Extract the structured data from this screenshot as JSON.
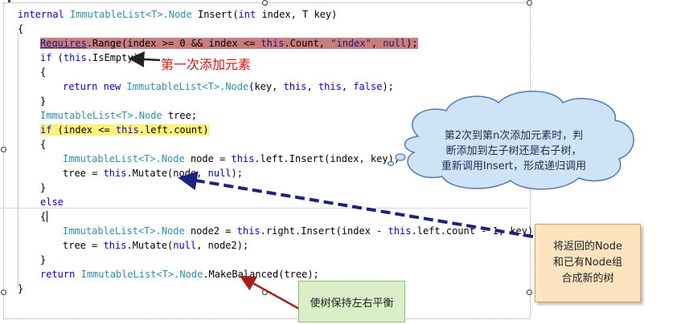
{
  "code": {
    "line1": {
      "internal": "internal",
      "type": "ImmutableList<T>.Node",
      "rest": " Insert(",
      "int": "int",
      "rest2": " index, T key)"
    },
    "line2": "{",
    "line3": {
      "requires": "Requires",
      "rest": ".Range(index >= 0 && index <= ",
      "this": "this",
      "rest2": ".Count, ",
      "str": "\"index\"",
      "rest3": ", ",
      "null": "null",
      "rest4": ");"
    },
    "line4": {
      "if": "if",
      "open": " (",
      "this": "this",
      "rest": ".IsEmpty)"
    },
    "line5": "{",
    "line6": {
      "return": "return",
      "new": "new",
      "type": "ImmutableList<T>.Node",
      "open": "(key, ",
      "this1": "this",
      "comma": ", ",
      "this2": "this",
      "comma2": ", ",
      "false": "false",
      "close": ");"
    },
    "line7": "}",
    "line8": {
      "type": "ImmutableList<T>.Node",
      "rest": " tree;"
    },
    "line9": {
      "if": "if",
      "open": " (index <= ",
      "this": "this",
      "rest": ".left.count)"
    },
    "line10": "{",
    "line11": {
      "type": "ImmutableList<T>.Node",
      "rest": " node = ",
      "this": "this",
      "rest2": ".left.Insert(index, key);"
    },
    "line12": {
      "pre": "tree = ",
      "this": "this",
      "mid": ".Mutate(node, ",
      "null": "null",
      "end": ");"
    },
    "line13": "}",
    "line14": "else",
    "line15": "{",
    "line16": {
      "type": "ImmutableList<T>.Node",
      "rest": " node2 = ",
      "this": "this",
      "rest2": ".right.Insert(index - ",
      "this2": "this",
      "rest3": ".left.count - 1, key);"
    },
    "line17": {
      "pre": "tree = ",
      "this": "this",
      "mid": ".Mutate(",
      "null": "null",
      "end": ", node2);"
    },
    "line18": "}",
    "line19": {
      "return": "return",
      "type": "ImmutableList<T>.Node",
      "rest": ".MakeBalanced(tree);"
    },
    "line20": "}"
  },
  "annotations": {
    "first_add": "第一次添加元素",
    "cloud_line1": "第2次到第n次添加元素时，判",
    "cloud_line2": "断添加到左子树还是右子树，",
    "cloud_line3": "重新调用Insert，形成递归调用",
    "orange_line1": "将返回的Node",
    "orange_line2": "和已有Node组",
    "orange_line3": "合成新的树",
    "green_label": "使树保持左右平衡"
  },
  "colors": {
    "keyword": "#0000ff",
    "type": "#2b91af",
    "string": "#a31515",
    "highlight_red": "#c97d7d",
    "highlight_yellow": "#fff27a",
    "annotation_red": "#e0120c",
    "arrow_navy": "#1a237e",
    "cloud_fill": "#cfe3f7",
    "orange_fill": "#fde3bf",
    "green_fill": "#d9edc7"
  }
}
